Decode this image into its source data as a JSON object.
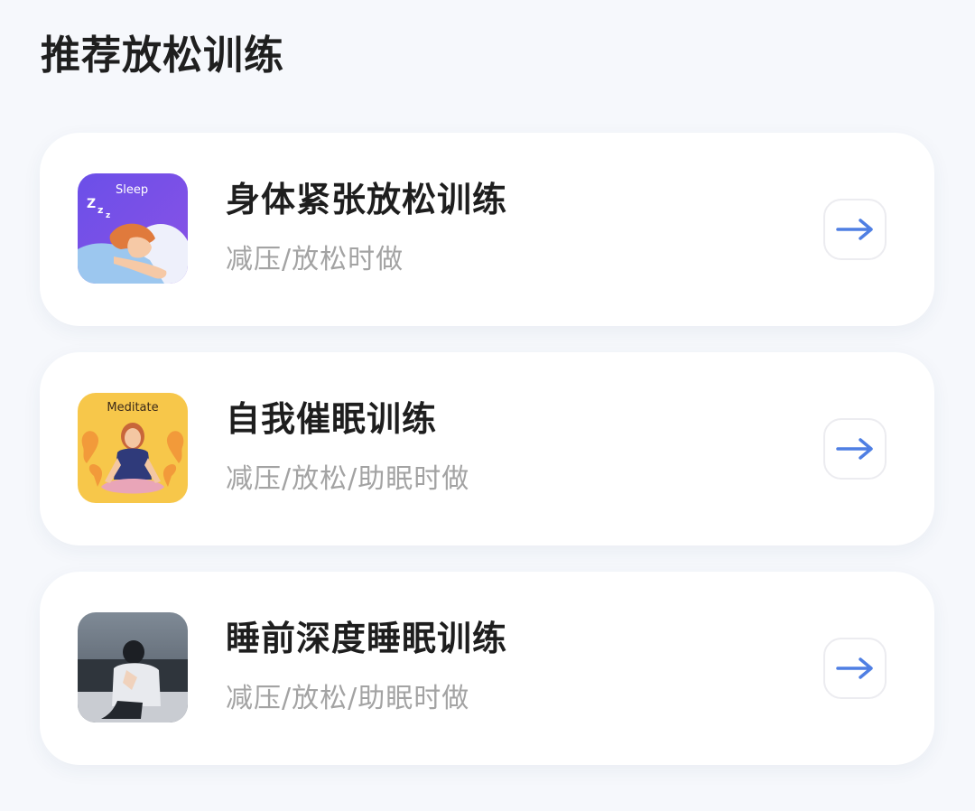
{
  "section": {
    "title": "推荐放松训练"
  },
  "colors": {
    "page_background": "#f6f8fc",
    "card_background": "#ffffff",
    "title_text": "#1e1e1e",
    "subtitle_text": "#a3a3a3",
    "arrow_accent": "#4f7fe3"
  },
  "cards": [
    {
      "title": "身体紧张放松训练",
      "subtitle": "减压/放松时做",
      "thumbnail_label": "Sleep",
      "thumbnail_icon": "sleeping-woman-illustration",
      "action_icon": "arrow-right-icon"
    },
    {
      "title": "自我催眠训练",
      "subtitle": "减压/放松/助眠时做",
      "thumbnail_label": "Meditate",
      "thumbnail_icon": "meditating-woman-illustration",
      "action_icon": "arrow-right-icon"
    },
    {
      "title": "睡前深度睡眠训练",
      "subtitle": "减压/放松/助眠时做",
      "thumbnail_label": "",
      "thumbnail_icon": "sitting-man-photo",
      "action_icon": "arrow-right-icon"
    }
  ]
}
